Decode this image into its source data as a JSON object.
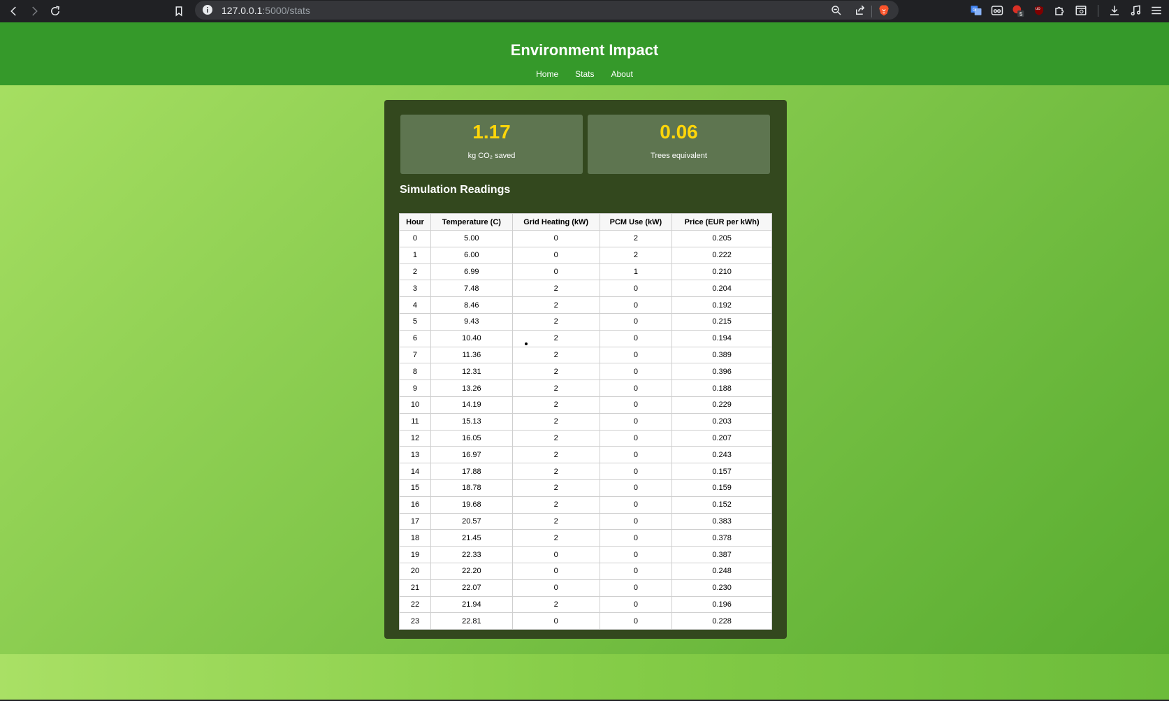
{
  "browser": {
    "url_host": "127.0.0.1",
    "url_path": ":5000/stats",
    "extension_badge": "5",
    "ublock_label": "uo"
  },
  "site": {
    "title": "Environment Impact",
    "nav": [
      "Home",
      "Stats",
      "About"
    ]
  },
  "stats": [
    {
      "value": "1.17",
      "label": "kg CO₂ saved"
    },
    {
      "value": "0.06",
      "label": "Trees equivalent"
    }
  ],
  "readings": {
    "title": "Simulation Readings",
    "headers": [
      "Hour",
      "Temperature (C)",
      "Grid Heating (kW)",
      "PCM Use (kW)",
      "Price (EUR per kWh)"
    ],
    "rows": [
      [
        "0",
        "5.00",
        "0",
        "2",
        "0.205"
      ],
      [
        "1",
        "6.00",
        "0",
        "2",
        "0.222"
      ],
      [
        "2",
        "6.99",
        "0",
        "1",
        "0.210"
      ],
      [
        "3",
        "7.48",
        "2",
        "0",
        "0.204"
      ],
      [
        "4",
        "8.46",
        "2",
        "0",
        "0.192"
      ],
      [
        "5",
        "9.43",
        "2",
        "0",
        "0.215"
      ],
      [
        "6",
        "10.40",
        "2",
        "0",
        "0.194"
      ],
      [
        "7",
        "11.36",
        "2",
        "0",
        "0.389"
      ],
      [
        "8",
        "12.31",
        "2",
        "0",
        "0.396"
      ],
      [
        "9",
        "13.26",
        "2",
        "0",
        "0.188"
      ],
      [
        "10",
        "14.19",
        "2",
        "0",
        "0.229"
      ],
      [
        "11",
        "15.13",
        "2",
        "0",
        "0.203"
      ],
      [
        "12",
        "16.05",
        "2",
        "0",
        "0.207"
      ],
      [
        "13",
        "16.97",
        "2",
        "0",
        "0.243"
      ],
      [
        "14",
        "17.88",
        "2",
        "0",
        "0.157"
      ],
      [
        "15",
        "18.78",
        "2",
        "0",
        "0.159"
      ],
      [
        "16",
        "19.68",
        "2",
        "0",
        "0.152"
      ],
      [
        "17",
        "20.57",
        "2",
        "0",
        "0.383"
      ],
      [
        "18",
        "21.45",
        "2",
        "0",
        "0.378"
      ],
      [
        "19",
        "22.33",
        "0",
        "0",
        "0.387"
      ],
      [
        "20",
        "22.20",
        "0",
        "0",
        "0.248"
      ],
      [
        "21",
        "22.07",
        "0",
        "0",
        "0.230"
      ],
      [
        "22",
        "21.94",
        "2",
        "0",
        "0.196"
      ],
      [
        "23",
        "22.81",
        "0",
        "0",
        "0.228"
      ]
    ]
  },
  "colors": {
    "header_green": "#35992a",
    "card_bg": "#33481e",
    "stat_value": "#ffd60a"
  }
}
